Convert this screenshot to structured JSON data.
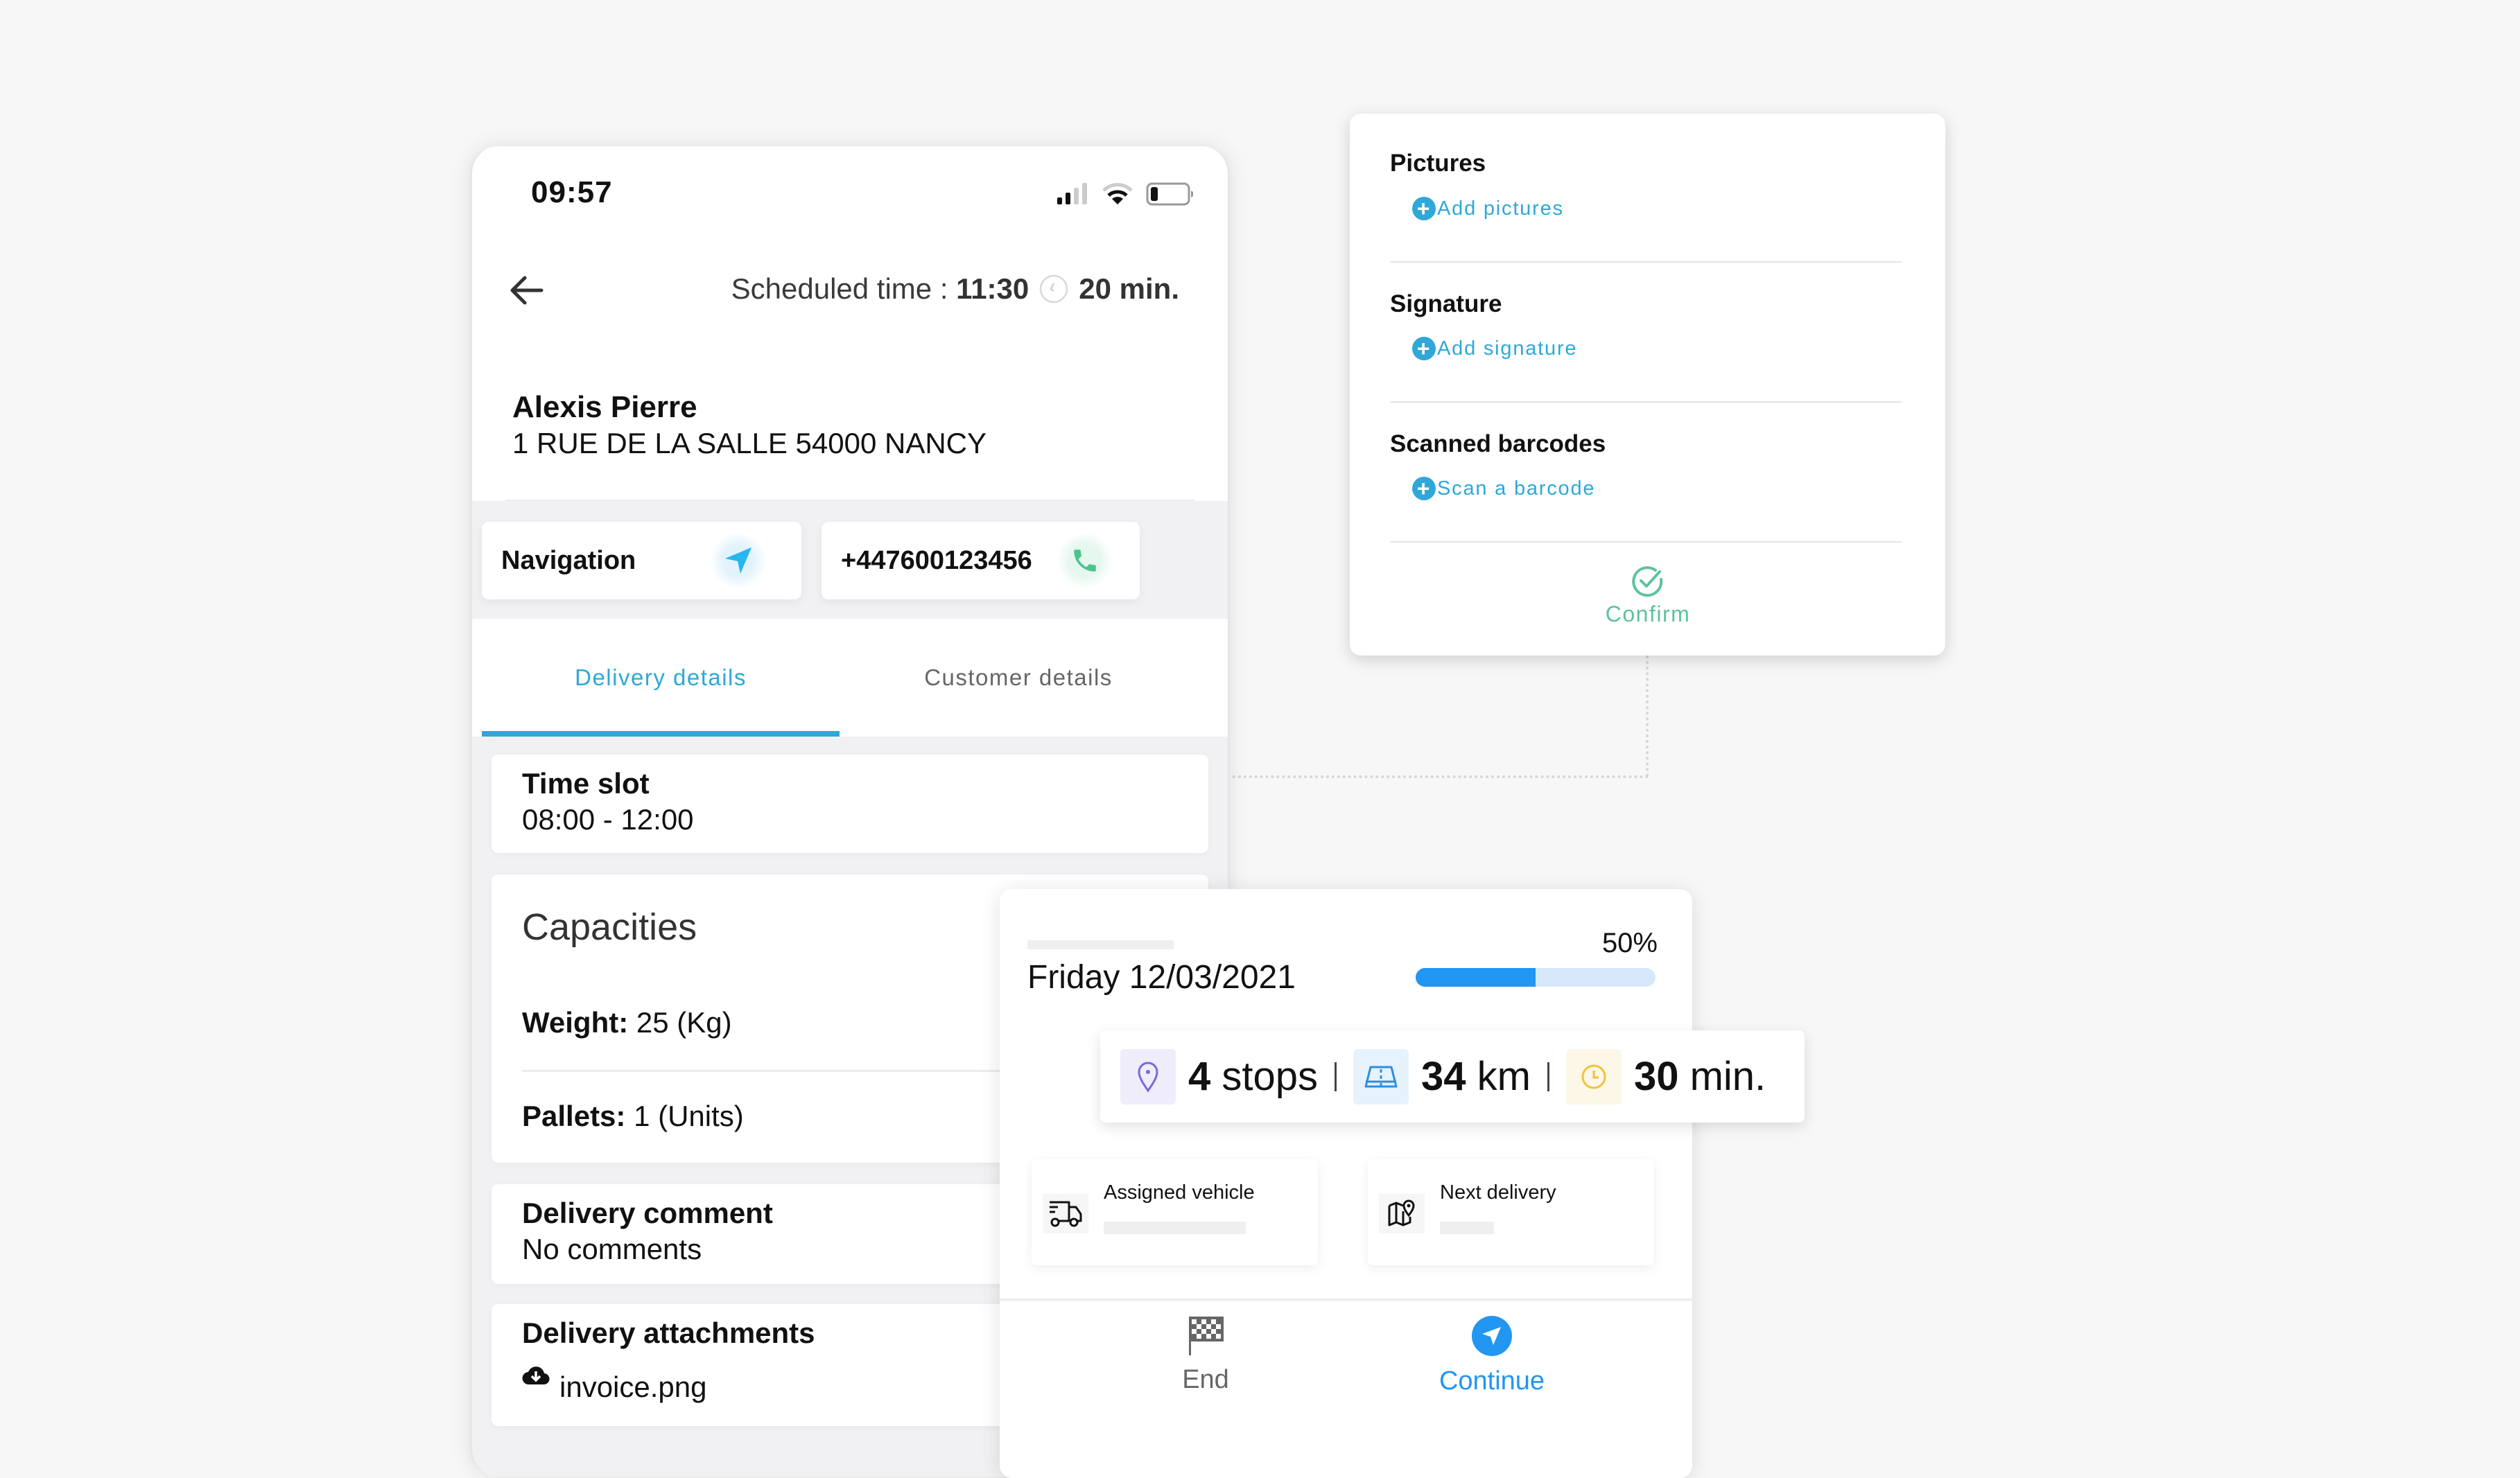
{
  "phone": {
    "status_time": "09:57",
    "scheduled_label": "Scheduled time : ",
    "scheduled_time": "11:30",
    "duration": "20 min.",
    "customer_name": "Alexis Pierre",
    "customer_address": "1 RUE DE LA SALLE 54000 NANCY",
    "navigation_label": "Navigation",
    "phone_number": "+447600123456",
    "tabs": [
      {
        "label": "Delivery details",
        "active": true
      },
      {
        "label": "Customer details",
        "active": false
      }
    ],
    "time_slot": {
      "title": "Time slot",
      "value": "08:00 - 12:00"
    },
    "capacities": {
      "title": "Capacities",
      "rows": [
        {
          "label": "Weight:",
          "value": " 25 (Kg)"
        },
        {
          "label": "Pallets:",
          "value": " 1 (Units)"
        }
      ]
    },
    "comment": {
      "title": "Delivery comment",
      "value": "No comments"
    },
    "attachments": {
      "title": "Delivery attachments",
      "file": "invoice.png"
    }
  },
  "popup": {
    "sections": [
      {
        "label": "Pictures",
        "action": "Add pictures"
      },
      {
        "label": "Signature",
        "action": "Add signature"
      },
      {
        "label": "Scanned barcodes",
        "action": "Scan a barcode"
      }
    ],
    "confirm_label": "Confirm"
  },
  "summary": {
    "date": "Friday 12/03/2021",
    "progress_percent": 50,
    "progress_label": "50%",
    "stats": {
      "stops_value": "4",
      "stops_unit": " stops",
      "distance_value": "34",
      "distance_unit": " km",
      "time_value": "30",
      "time_unit": " min."
    },
    "assigned_vehicle_label": "Assigned vehicle",
    "next_delivery_label": "Next delivery",
    "end_label": "End",
    "continue_label": "Continue"
  },
  "colors": {
    "accent_blue": "#2ea8d8",
    "progress_blue": "#2196f3",
    "confirm_green": "#5cc39a",
    "phone_green": "#4cc38a",
    "stops_purple": "#7b68d9",
    "time_yellow": "#f0c23b"
  }
}
